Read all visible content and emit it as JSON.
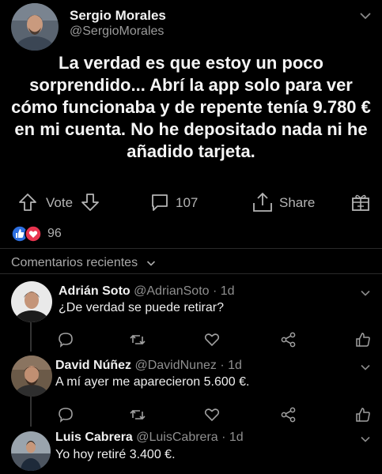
{
  "post": {
    "author_name": "Sergio Morales",
    "author_handle": "@SergioMorales",
    "text": "La verdad es que estoy un poco sorprendido... Abrí la app solo para ver cómo funcionaba y de repente tenía 9.780 € en mi cuenta. No he depositado nada ni he añadido tarjeta.",
    "vote_label": "Vote",
    "comment_count": "107",
    "share_label": "Share",
    "reaction_count": "96"
  },
  "comments_section": {
    "title": "Comentarios recientes"
  },
  "comments": [
    {
      "name": "Adrián Soto",
      "handle": "@AdrianSoto · 1d",
      "text": "¿De verdad se puede retirar?"
    },
    {
      "name": "David Núñez",
      "handle": "@DavidNunez · 1d",
      "text": "A mí ayer me aparecieron 5.600 €."
    },
    {
      "name": "Luis Cabrera",
      "handle": "@LuisCabrera · 1d",
      "text": "Yo hoy retiré 3.400 €."
    }
  ],
  "colors": {
    "background": "#000000",
    "like_blue": "#2d6fe0",
    "love_red": "#e8344f"
  },
  "icons": [
    "chevron-down-icon",
    "upvote-arrow-icon",
    "downvote-arrow-icon",
    "comment-bubble-icon",
    "share-icon",
    "gift-icon",
    "like-reaction-icon",
    "love-reaction-icon",
    "reply-icon",
    "retweet-icon",
    "heart-icon",
    "comment-share-icon",
    "thumbs-up-icon"
  ]
}
